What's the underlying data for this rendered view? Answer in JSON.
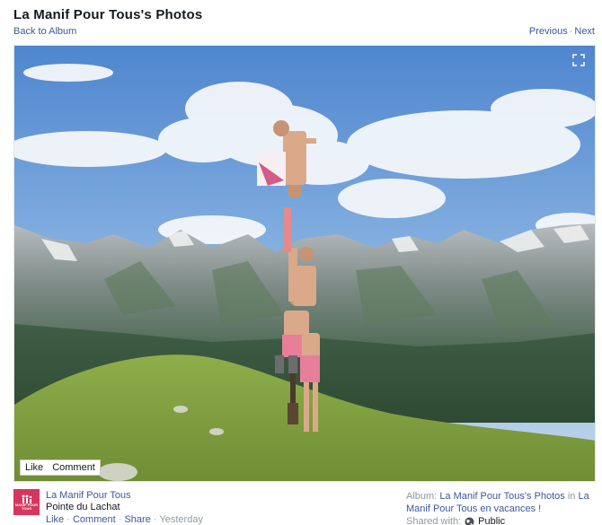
{
  "header": {
    "title": "La Manif Pour Tous's Photos",
    "back_label": "Back to Album",
    "previous_label": "Previous",
    "separator": "·",
    "next_label": "Next"
  },
  "photo": {
    "like_label": "Like",
    "comment_label": "Comment",
    "expand_icon": "expand-icon"
  },
  "footer": {
    "owner_name": "La Manif Pour Tous",
    "avatar_logo": "MANIF POUR TOUS",
    "caption": "Pointe du Lachat",
    "actions": {
      "like": "Like",
      "comment": "Comment",
      "share": "Share",
      "separator": "·",
      "timestamp": "Yesterday"
    },
    "album_prefix": "Album:",
    "album_link": "La Manif Pour Tous's Photos",
    "album_in": "in",
    "album_location_link": "La Manif Pour Tous en vacances !",
    "shared_label": "Shared with:",
    "shared_icon": "globe-icon",
    "shared_value": "Public"
  },
  "colors": {
    "link": "#3b5998",
    "muted": "#9197a3",
    "avatar_bg": "#d6365c",
    "sky": "#6ea0d6",
    "grass": "#7c9a3c"
  }
}
